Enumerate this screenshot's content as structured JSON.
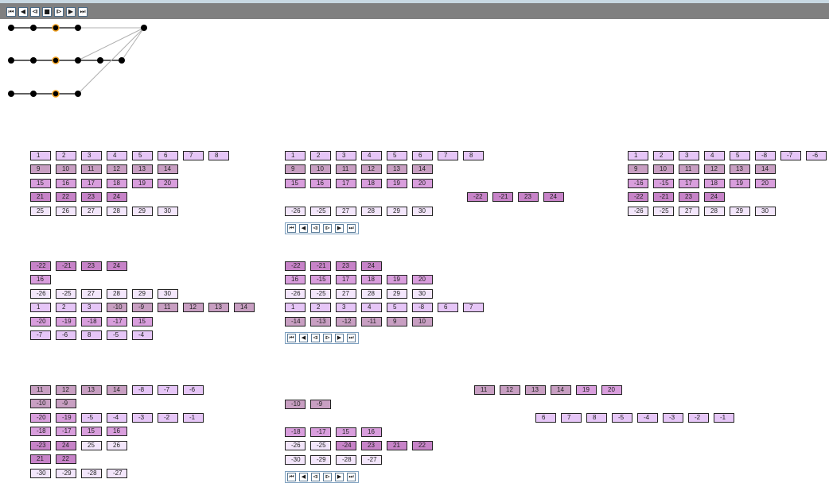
{
  "playback": {
    "buttons": [
      {
        "name": "first-frame-icon",
        "glyph": "⏮"
      },
      {
        "name": "prev-frame-icon",
        "glyph": "◀"
      },
      {
        "name": "step-back-icon",
        "glyph": "⧏"
      },
      {
        "name": "stop-icon",
        "glyph": "■"
      },
      {
        "name": "step-forward-icon",
        "glyph": "⧐"
      },
      {
        "name": "next-frame-icon",
        "glyph": "▶"
      },
      {
        "name": "last-frame-icon",
        "glyph": "⏭"
      }
    ]
  },
  "mini_controls": [
    "⏮",
    "◀",
    "⧏",
    "⧐",
    "▶",
    "⏭"
  ],
  "colors": {
    "bar": "#808080",
    "node": "#000000",
    "highlight": "#f0a020"
  },
  "panels": [
    {
      "name": "panel-1",
      "rows": [
        [
          [
            "1",
            0
          ],
          [
            "2",
            0
          ],
          [
            "3",
            0
          ],
          [
            "4",
            0
          ],
          [
            "5",
            0
          ],
          [
            "6",
            0
          ],
          [
            "7",
            0
          ],
          [
            "8",
            0
          ]
        ],
        [
          [
            "9",
            2
          ],
          [
            "10",
            2
          ],
          [
            "11",
            2
          ],
          [
            "12",
            2
          ],
          [
            "13",
            2
          ],
          [
            "14",
            2
          ]
        ],
        [
          [
            "15",
            1
          ],
          [
            "16",
            1
          ],
          [
            "17",
            1
          ],
          [
            "18",
            1
          ],
          [
            "19",
            1
          ],
          [
            "20",
            1
          ]
        ],
        [
          [
            "21",
            3
          ],
          [
            "22",
            3
          ],
          [
            "23",
            3
          ],
          [
            "24",
            3
          ]
        ],
        [
          [
            "25",
            4
          ],
          [
            "26",
            4
          ],
          [
            "27",
            4
          ],
          [
            "28",
            4
          ],
          [
            "29",
            4
          ],
          [
            "30",
            4
          ]
        ]
      ]
    },
    {
      "name": "panel-2",
      "rows": [
        [
          [
            "1",
            0
          ],
          [
            "2",
            0
          ],
          [
            "3",
            0
          ],
          [
            "4",
            0
          ],
          [
            "5",
            0
          ],
          [
            "6",
            0
          ],
          [
            "7",
            0
          ],
          [
            "8",
            0
          ]
        ],
        [
          [
            "9",
            2
          ],
          [
            "10",
            2
          ],
          [
            "11",
            2
          ],
          [
            "12",
            2
          ],
          [
            "13",
            2
          ],
          [
            "14",
            2
          ]
        ],
        [
          [
            "15",
            1
          ],
          [
            "16",
            1
          ],
          [
            "17",
            1
          ],
          [
            "18",
            1
          ],
          [
            "19",
            1
          ],
          [
            "20",
            1
          ]
        ],
        [
          [
            "-22",
            3
          ],
          [
            "-21",
            3
          ],
          [
            "23",
            3
          ],
          [
            "24",
            3
          ]
        ],
        [
          [
            "-26",
            4
          ],
          [
            "-25",
            4
          ],
          [
            "27",
            4
          ],
          [
            "28",
            4
          ],
          [
            "29",
            4
          ],
          [
            "30",
            4
          ]
        ]
      ]
    },
    {
      "name": "panel-3",
      "rows": [
        [
          [
            "1",
            0
          ],
          [
            "2",
            0
          ],
          [
            "3",
            0
          ],
          [
            "4",
            0
          ],
          [
            "5",
            0
          ],
          [
            "-8",
            0
          ],
          [
            "-7",
            0
          ],
          [
            "-6",
            0
          ]
        ],
        [
          [
            "9",
            2
          ],
          [
            "10",
            2
          ],
          [
            "11",
            2
          ],
          [
            "12",
            2
          ],
          [
            "13",
            2
          ],
          [
            "14",
            2
          ]
        ],
        [
          [
            "-16",
            1
          ],
          [
            "-15",
            1
          ],
          [
            "17",
            1
          ],
          [
            "18",
            1
          ],
          [
            "19",
            1
          ],
          [
            "20",
            1
          ]
        ],
        [
          [
            "-22",
            3
          ],
          [
            "-21",
            3
          ],
          [
            "23",
            3
          ],
          [
            "24",
            3
          ]
        ],
        [
          [
            "-26",
            4
          ],
          [
            "-25",
            4
          ],
          [
            "27",
            4
          ],
          [
            "28",
            4
          ],
          [
            "29",
            4
          ],
          [
            "30",
            4
          ]
        ]
      ]
    },
    {
      "name": "panel-4",
      "rows": [
        [
          [
            "-22",
            3
          ],
          [
            "-21",
            3
          ],
          [
            "23",
            3
          ],
          [
            "24",
            3
          ]
        ],
        [
          [
            "16",
            1
          ]
        ],
        [
          [
            "-26",
            4
          ],
          [
            "-25",
            4
          ],
          [
            "27",
            4
          ],
          [
            "28",
            4
          ],
          [
            "29",
            4
          ],
          [
            "30",
            4
          ]
        ],
        [
          [
            "1",
            0
          ],
          [
            "2",
            0
          ],
          [
            "3",
            0
          ],
          [
            "-10",
            2
          ],
          [
            "-9",
            2
          ],
          [
            "11",
            2
          ],
          [
            "12",
            2
          ],
          [
            "13",
            2
          ],
          [
            "14",
            2
          ]
        ],
        [
          [
            "-20",
            1
          ],
          [
            "-19",
            1
          ],
          [
            "-18",
            1
          ],
          [
            "-17",
            1
          ],
          [
            "15",
            1
          ]
        ],
        [
          [
            "-7",
            0
          ],
          [
            "-6",
            0
          ],
          [
            "8",
            0
          ],
          [
            "-5",
            0
          ],
          [
            "-4",
            0
          ]
        ]
      ]
    },
    {
      "name": "panel-5",
      "rows": [
        [
          [
            "-22",
            3
          ],
          [
            "-21",
            3
          ],
          [
            "23",
            3
          ],
          [
            "24",
            3
          ]
        ],
        [
          [
            "16",
            1
          ],
          [
            "-15",
            1
          ],
          [
            "17",
            1
          ],
          [
            "18",
            1
          ],
          [
            "19",
            1
          ],
          [
            "20",
            1
          ]
        ],
        [
          [
            "-26",
            4
          ],
          [
            "-25",
            4
          ],
          [
            "27",
            4
          ],
          [
            "28",
            4
          ],
          [
            "29",
            4
          ],
          [
            "30",
            4
          ]
        ],
        [
          [
            "1",
            0
          ],
          [
            "2",
            0
          ],
          [
            "3",
            0
          ],
          [
            "4",
            0
          ],
          [
            "5",
            0
          ],
          [
            "-8",
            0
          ],
          [
            "6",
            0
          ],
          [
            "7",
            0
          ]
        ],
        [
          [
            "-14",
            2
          ],
          [
            "-13",
            2
          ],
          [
            "-12",
            2
          ],
          [
            "-11",
            2
          ],
          [
            "9",
            2
          ],
          [
            "10",
            2
          ]
        ]
      ]
    },
    {
      "name": "panel-6",
      "rows": [
        [
          [
            "11",
            2
          ],
          [
            "12",
            2
          ],
          [
            "13",
            2
          ],
          [
            "14",
            2
          ],
          [
            "-8",
            0
          ],
          [
            "-7",
            0
          ],
          [
            "-6",
            0
          ]
        ],
        [
          [
            "-10",
            2
          ],
          [
            "-9",
            2
          ]
        ],
        [
          [
            "-20",
            1
          ],
          [
            "-19",
            1
          ],
          [
            "-5",
            0
          ],
          [
            "-4",
            0
          ],
          [
            "-3",
            0
          ],
          [
            "-2",
            0
          ],
          [
            "-1",
            0
          ]
        ],
        [
          [
            "-18",
            1
          ],
          [
            "-17",
            1
          ],
          [
            "15",
            1
          ],
          [
            "16",
            1
          ]
        ],
        [
          [
            "-23",
            3
          ],
          [
            "24",
            3
          ],
          [
            "25",
            4
          ],
          [
            "26",
            4
          ]
        ],
        [
          [
            "21",
            3
          ],
          [
            "22",
            3
          ]
        ],
        [
          [
            "-30",
            4
          ],
          [
            "-29",
            4
          ],
          [
            "-28",
            4
          ],
          [
            "-27",
            4
          ]
        ]
      ]
    },
    {
      "name": "panel-7",
      "rows": [
        [
          [
            "-10",
            2
          ],
          [
            "-9",
            2
          ]
        ],
        [
          [
            "-18",
            1
          ],
          [
            "-17",
            1
          ],
          [
            "15",
            1
          ],
          [
            "16",
            1
          ]
        ],
        [
          [
            "-26",
            4
          ],
          [
            "-25",
            4
          ],
          [
            "-24",
            3
          ],
          [
            "23",
            3
          ],
          [
            "21",
            3
          ],
          [
            "22",
            3
          ]
        ],
        [
          [
            "-30",
            4
          ],
          [
            "-29",
            4
          ],
          [
            "-28",
            4
          ],
          [
            "-27",
            4
          ]
        ]
      ]
    },
    {
      "name": "panel-8",
      "rows": [
        [
          [
            "11",
            2
          ],
          [
            "12",
            2
          ],
          [
            "13",
            2
          ],
          [
            "14",
            2
          ],
          [
            "19",
            1
          ],
          [
            "20",
            1
          ]
        ]
      ]
    },
    {
      "name": "panel-9",
      "rows": [
        [
          [
            "6",
            0
          ],
          [
            "7",
            0
          ],
          [
            "8",
            0
          ],
          [
            "-5",
            0
          ],
          [
            "-4",
            0
          ],
          [
            "-3",
            0
          ],
          [
            "-2",
            0
          ],
          [
            "-1",
            0
          ]
        ]
      ]
    }
  ]
}
